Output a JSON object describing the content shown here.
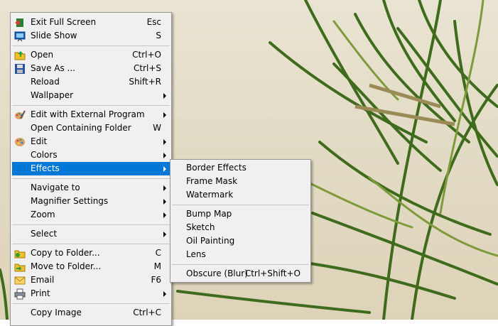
{
  "main_menu": {
    "items": [
      {
        "label": "Exit Full Screen",
        "shortcut": "Esc",
        "icon": "exit-fullscreen-icon"
      },
      {
        "label": "Slide Show",
        "shortcut": "S",
        "icon": "slideshow-icon"
      },
      {
        "label": "Open",
        "shortcut": "Ctrl+O",
        "icon": "open-folder-icon"
      },
      {
        "label": "Save As ...",
        "shortcut": "Ctrl+S",
        "icon": "floppy-disk-icon"
      },
      {
        "label": "Reload",
        "shortcut": "Shift+R"
      },
      {
        "label": "Wallpaper",
        "shortcut": "",
        "submenu": true
      },
      {
        "label": "Edit with External Program",
        "shortcut": "",
        "icon": "palette-brush-icon",
        "submenu": true
      },
      {
        "label": "Open Containing Folder",
        "shortcut": "W"
      },
      {
        "label": "Edit",
        "shortcut": "",
        "icon": "palette-icon",
        "submenu": true
      },
      {
        "label": "Colors",
        "shortcut": "",
        "submenu": true
      },
      {
        "label": "Effects",
        "shortcut": "",
        "submenu": true,
        "highlighted": true
      },
      {
        "label": "Navigate to",
        "shortcut": "",
        "submenu": true
      },
      {
        "label": "Magnifier Settings",
        "shortcut": "",
        "submenu": true
      },
      {
        "label": "Zoom",
        "shortcut": "",
        "submenu": true
      },
      {
        "label": "Select",
        "shortcut": "",
        "submenu": true
      },
      {
        "label": "Copy to Folder...",
        "shortcut": "C",
        "icon": "copy-to-folder-icon"
      },
      {
        "label": "Move to Folder...",
        "shortcut": "M",
        "icon": "move-to-folder-icon"
      },
      {
        "label": "Email",
        "shortcut": "F6",
        "icon": "email-icon"
      },
      {
        "label": "Print",
        "shortcut": "",
        "icon": "printer-icon",
        "submenu": true
      },
      {
        "label": "Copy Image",
        "shortcut": "Ctrl+C"
      }
    ]
  },
  "effects_submenu": {
    "items": [
      {
        "label": "Border Effects",
        "shortcut": ""
      },
      {
        "label": "Frame Mask",
        "shortcut": ""
      },
      {
        "label": "Watermark",
        "shortcut": ""
      },
      {
        "label": "Bump Map",
        "shortcut": ""
      },
      {
        "label": "Sketch",
        "shortcut": ""
      },
      {
        "label": "Oil Painting",
        "shortcut": ""
      },
      {
        "label": "Lens",
        "shortcut": ""
      },
      {
        "label": "Obscure (Blur)",
        "shortcut": "Ctrl+Shift+O"
      }
    ]
  },
  "colors": {
    "highlight": "#0078d7",
    "menu_bg": "#f0f0f0",
    "leaf": "#3f6b1c"
  }
}
